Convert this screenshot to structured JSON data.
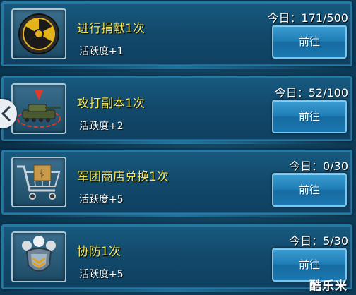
{
  "tasks": [
    {
      "title": "进行捐献1次",
      "reward": "活跃度+1",
      "progress": "今日：171/500",
      "button_label": "前往",
      "icon": "radiation-icon"
    },
    {
      "title": "攻打副本1次",
      "reward": "活跃度+2",
      "progress": "今日：52/100",
      "button_label": "前往",
      "icon": "tank-target-icon"
    },
    {
      "title": "军团商店兑换1次",
      "reward": "活跃度+5",
      "progress": "今日：0/30",
      "button_label": "前往",
      "icon": "shopping-cart-icon"
    },
    {
      "title": "协防1次",
      "reward": "活跃度+5",
      "progress": "今日：5/30",
      "button_label": "前往",
      "icon": "shield-team-icon"
    }
  ],
  "side_tab": {
    "icon": "chevron-left-icon"
  },
  "watermark": "酷乐米",
  "colors": {
    "title": "#f3e65c",
    "card": "#124a6c",
    "button": "#1f7db6",
    "background": "#0b3550"
  }
}
